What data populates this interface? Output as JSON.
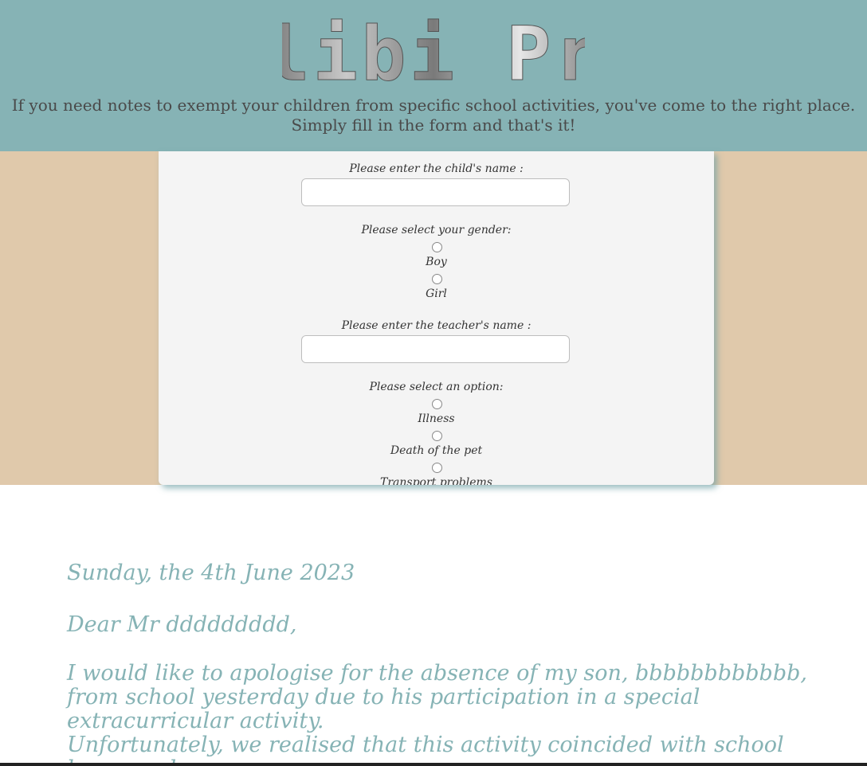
{
  "header": {
    "logo_text": "Alibi Pro",
    "intro": "If you need notes to exempt your children from specific school activities, you've come to the right place. Simply fill in the form and that's it!"
  },
  "form": {
    "child_name_label": "Please enter the child's name :",
    "child_name_value": "",
    "gender_label": "Please select your gender:",
    "gender_options": [
      "Boy",
      "Girl"
    ],
    "teacher_name_label": "Please enter the teacher's name :",
    "teacher_name_value": "",
    "option_label": "Please select an option:",
    "options": [
      "Illness",
      "Death of the pet",
      "Transport problems"
    ]
  },
  "letter": {
    "date": "Sunday, the 4th June 2023",
    "greeting": "Dear Mr ddddddddd,",
    "paragraph1": "I would like to apologise for the absence of my son, bbbbbbbbbbbb, from school yesterday due to his participation in a special extracurricular activity.",
    "paragraph2": "Unfortunately, we realised that this activity coincided with school hours and we were"
  },
  "colors": {
    "header_bg": "#86b3b5",
    "band_bg": "#e0c9ab",
    "panel_bg": "#f4f4f4",
    "letter_text": "#86b3b5"
  }
}
